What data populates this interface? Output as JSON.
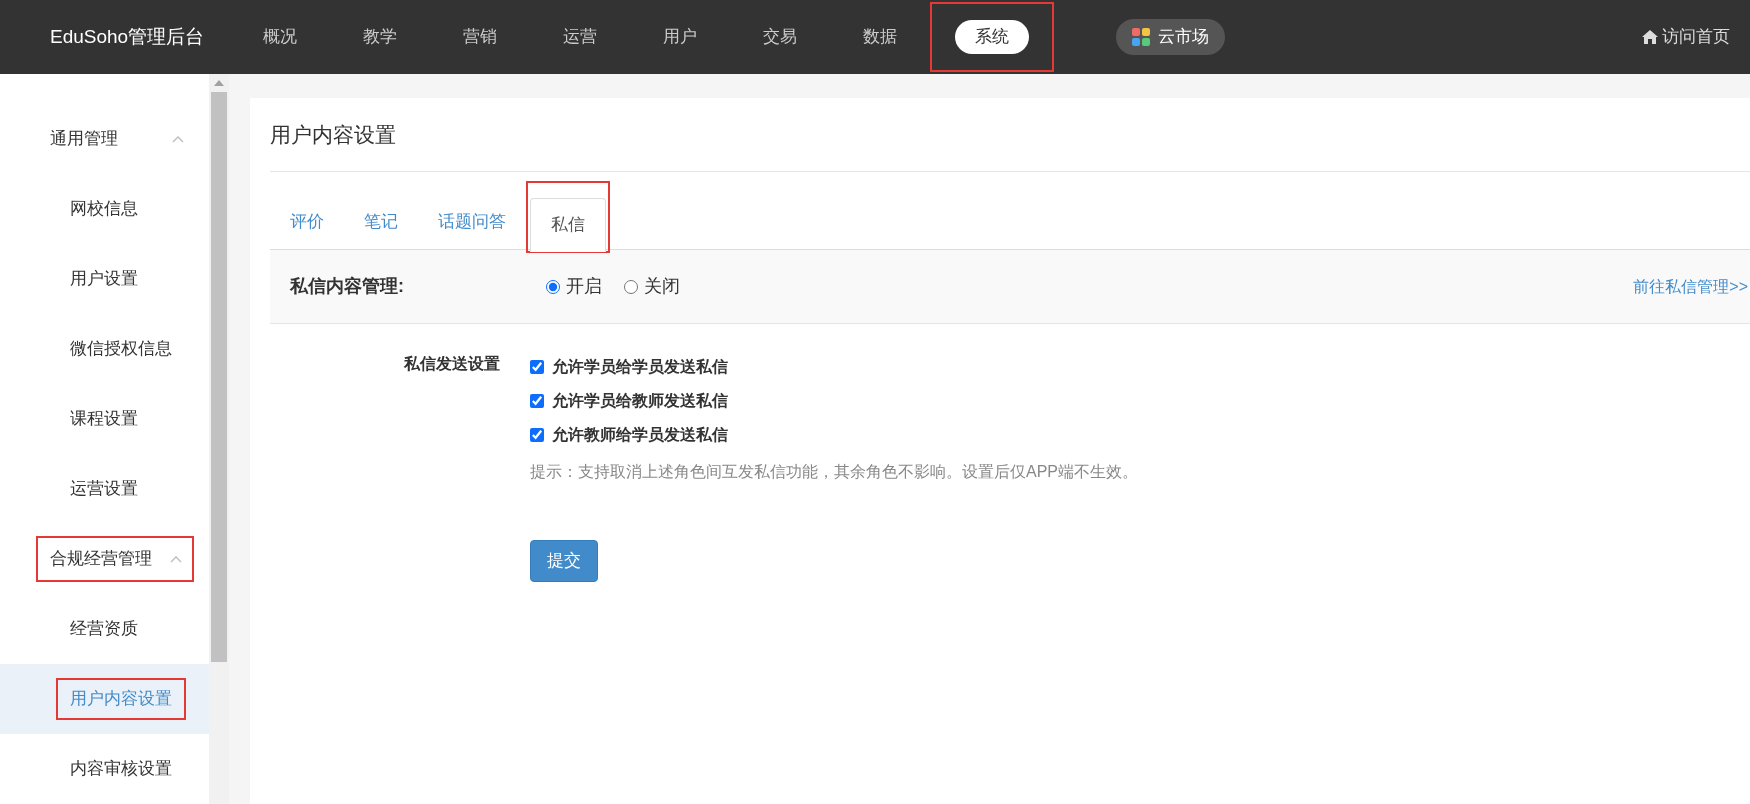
{
  "topbar": {
    "brand": "EduSoho管理后台",
    "nav": [
      {
        "label": "概况",
        "selected": false,
        "annotated": false
      },
      {
        "label": "教学",
        "selected": false,
        "annotated": false
      },
      {
        "label": "营销",
        "selected": false,
        "annotated": false
      },
      {
        "label": "运营",
        "selected": false,
        "annotated": false
      },
      {
        "label": "用户",
        "selected": false,
        "annotated": false
      },
      {
        "label": "交易",
        "selected": false,
        "annotated": false
      },
      {
        "label": "数据",
        "selected": false,
        "annotated": false
      },
      {
        "label": "系统",
        "selected": true,
        "annotated": true
      }
    ],
    "market": "云市场",
    "home_link": "访问首页"
  },
  "sidebar": {
    "groups": [
      {
        "label": "通用管理",
        "expanded": true,
        "annotated": false,
        "children": [
          {
            "label": "网校信息",
            "selected": false,
            "annotated": false
          },
          {
            "label": "用户设置",
            "selected": false,
            "annotated": false
          },
          {
            "label": "微信授权信息",
            "selected": false,
            "annotated": false
          },
          {
            "label": "课程设置",
            "selected": false,
            "annotated": false
          },
          {
            "label": "运营设置",
            "selected": false,
            "annotated": false
          }
        ]
      },
      {
        "label": "合规经营管理",
        "expanded": true,
        "annotated": true,
        "children": [
          {
            "label": "经营资质",
            "selected": false,
            "annotated": false
          },
          {
            "label": "用户内容设置",
            "selected": true,
            "annotated": true
          },
          {
            "label": "内容审核设置",
            "selected": false,
            "annotated": false
          }
        ]
      }
    ]
  },
  "page": {
    "title": "用户内容设置",
    "tabs": [
      {
        "label": "评价",
        "selected": false,
        "annotated": false
      },
      {
        "label": "笔记",
        "selected": false,
        "annotated": false
      },
      {
        "label": "话题问答",
        "selected": false,
        "annotated": false
      },
      {
        "label": "私信",
        "selected": true,
        "annotated": true
      }
    ],
    "management": {
      "label": "私信内容管理:",
      "options": [
        {
          "label": "开启",
          "selected": true
        },
        {
          "label": "关闭",
          "selected": false
        }
      ],
      "link": "前往私信管理>>"
    },
    "send_settings": {
      "label": "私信发送设置",
      "options": [
        {
          "label": "允许学员给学员发送私信",
          "checked": true
        },
        {
          "label": "允许学员给教师发送私信",
          "checked": true
        },
        {
          "label": "允许教师给学员发送私信",
          "checked": true
        }
      ],
      "hint": "提示：支持取消上述角色间互发私信功能，其余角色不影响。设置后仅APP端不生效。"
    },
    "submit": "提交"
  }
}
